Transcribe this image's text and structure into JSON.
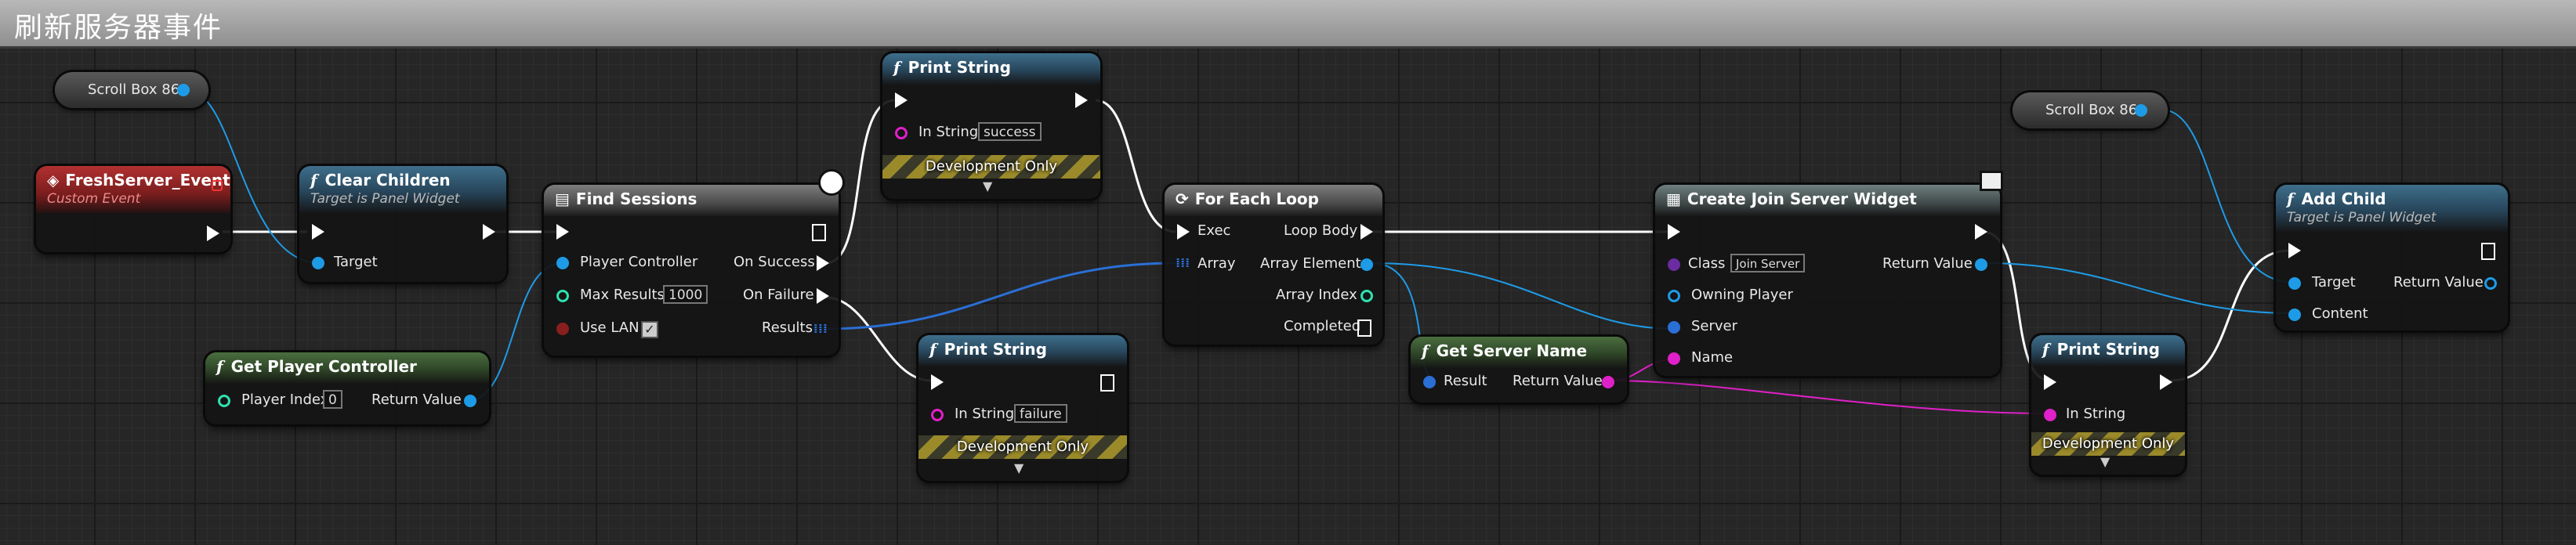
{
  "graph_title": "刷新服务器事件",
  "colors": {
    "exec": "#ffffff",
    "object": "#1e9be6",
    "struct": "#2a6fd6",
    "int": "#2fe0b0",
    "string": "#e020c8",
    "bool": "#8a1f1f",
    "class": "#6a2ca0"
  },
  "nodes": {
    "scroll_box_1": {
      "label": "Scroll Box 86"
    },
    "scroll_box_2": {
      "label": "Scroll Box 86"
    },
    "fresh_event": {
      "title": "FreshServer_Event",
      "subtitle": "Custom Event"
    },
    "clear_children": {
      "title": "Clear Children",
      "subtitle": "Target is Panel Widget",
      "target": "Target"
    },
    "get_player_controller": {
      "title": "Get Player Controller",
      "player_index_label": "Player Index",
      "player_index_value": "0",
      "return_label": "Return Value"
    },
    "find_sessions": {
      "title": "Find Sessions",
      "player_controller": "Player Controller",
      "max_results_label": "Max Results",
      "max_results_value": "1000",
      "use_lan": "Use LAN",
      "on_success": "On Success",
      "on_failure": "On Failure",
      "results": "Results"
    },
    "print_success": {
      "title": "Print String",
      "in_string": "In String",
      "value": "success",
      "dev": "Development Only"
    },
    "print_failure": {
      "title": "Print String",
      "in_string": "In String",
      "value": "failure",
      "dev": "Development Only"
    },
    "for_each": {
      "title": "For Each Loop",
      "exec": "Exec",
      "array": "Array",
      "loop_body": "Loop Body",
      "array_element": "Array Element",
      "array_index": "Array Index",
      "completed": "Completed"
    },
    "get_server_name": {
      "title": "Get Server Name",
      "result": "Result",
      "return_label": "Return Value"
    },
    "create_widget": {
      "title": "Create Join Server Widget",
      "class_label": "Class",
      "class_value": "Join Server",
      "owning_player": "Owning Player",
      "server": "Server",
      "name": "Name",
      "return_label": "Return Value"
    },
    "print_name": {
      "title": "Print String",
      "in_string": "In String",
      "dev": "Development Only"
    },
    "add_child": {
      "title": "Add Child",
      "subtitle": "Target is Panel Widget",
      "target": "Target",
      "content": "Content",
      "return_label": "Return Value"
    }
  }
}
